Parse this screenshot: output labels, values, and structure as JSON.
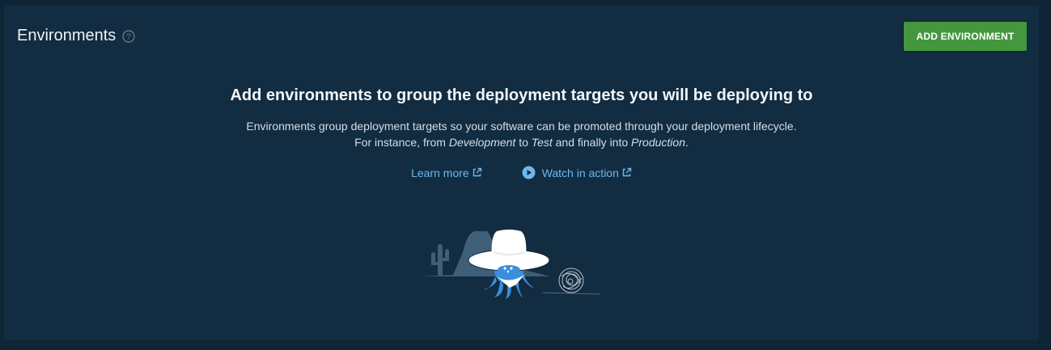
{
  "header": {
    "title": "Environments",
    "add_button": "ADD ENVIRONMENT"
  },
  "empty_state": {
    "headline": "Add environments to group the deployment targets you will be deploying to",
    "description_line1": "Environments group deployment targets so your software can be promoted through your deployment lifecycle.",
    "line2_prefix": "For instance, from ",
    "env_development": "Development",
    "line2_mid1": " to ",
    "env_test": "Test",
    "line2_mid2": " and finally into ",
    "env_production": "Production",
    "line2_suffix": ".",
    "learn_more": "Learn more",
    "watch_in_action": "Watch in action"
  },
  "icons": [
    "help-icon",
    "external-link-icon",
    "play-icon"
  ],
  "colors": {
    "background": "#0f2535",
    "panel": "#122c41",
    "accent_green": "#44973f",
    "link_blue": "#6cb8ee"
  }
}
